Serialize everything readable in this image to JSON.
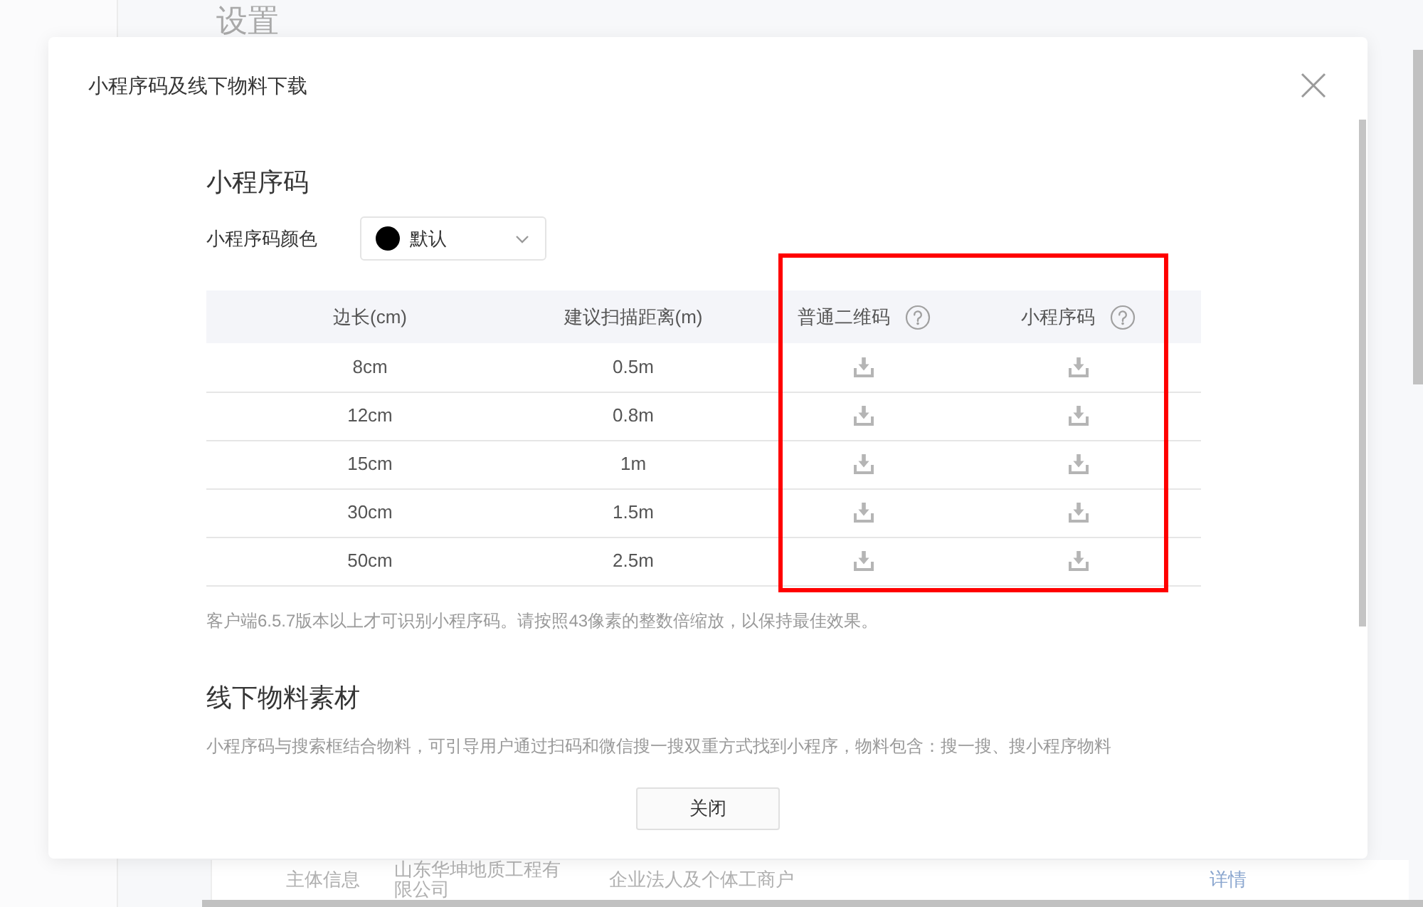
{
  "background_page": {
    "title": "设置",
    "info_row": {
      "label": "主体信息",
      "company": "山东华坤地质工程有限公司",
      "company_type": "企业法人及个体工商户",
      "link": "详情"
    }
  },
  "dialog": {
    "title": "小程序码及线下物料下载",
    "code_section": {
      "heading": "小程序码",
      "color_label": "小程序码颜色",
      "color_select": {
        "value": "默认",
        "color": "#000000"
      },
      "table": {
        "columns": [
          {
            "label": "边长(cm)",
            "kind": "text",
            "help": false,
            "highlighted": false
          },
          {
            "label": "建议扫描距离(m)",
            "kind": "text",
            "help": false,
            "highlighted": false
          },
          {
            "label": "普通二维码",
            "kind": "download",
            "help": true,
            "highlighted": true
          },
          {
            "label": "小程序码",
            "kind": "download",
            "help": true,
            "highlighted": true
          }
        ],
        "rows": [
          {
            "cells": [
              "8cm",
              "0.5m"
            ]
          },
          {
            "cells": [
              "12cm",
              "0.8m"
            ]
          },
          {
            "cells": [
              "15cm",
              "1m"
            ]
          },
          {
            "cells": [
              "30cm",
              "1.5m"
            ]
          },
          {
            "cells": [
              "50cm",
              "2.5m"
            ]
          }
        ]
      },
      "note": "客户端6.5.7版本以上才可识别小程序码。请按照43像素的整数倍缩放，以保持最佳效果。"
    },
    "materials_section": {
      "heading": "线下物料素材",
      "description": "小程序码与搜索框结合物料，可引导用户通过扫码和微信搜一搜双重方式找到小程序，物料包含：搜一搜、搜小程序物料"
    },
    "footer_button": "关闭"
  }
}
